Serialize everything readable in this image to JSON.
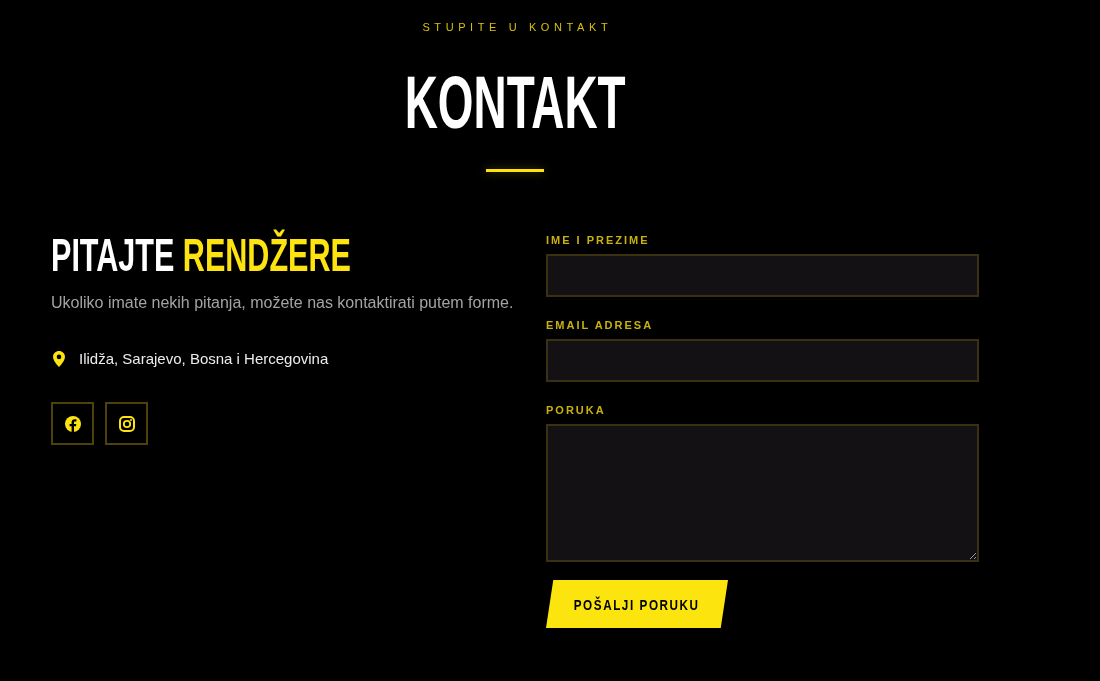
{
  "header": {
    "eyebrow": "STUPITE U KONTAKT",
    "title": "KONTAKT"
  },
  "intro": {
    "title_lead": "PITAJTE",
    "title_highlight": "RENDŽERE",
    "text": "Ukoliko imate nekih pitanja, možete nas kontaktirati putem forme.",
    "address": "Ilidža, Sarajevo, Bosna i Hercegovina",
    "social_links": [
      {
        "kind": "facebook"
      },
      {
        "kind": "instagram"
      }
    ]
  },
  "form": {
    "fields": [
      {
        "kind": "input",
        "label": "IME I PREZIME"
      },
      {
        "kind": "input",
        "label": "EMAIL ADRESA"
      },
      {
        "kind": "textarea",
        "label": "PORUKA"
      }
    ],
    "submit": "POŠALJI PORUKU"
  }
}
